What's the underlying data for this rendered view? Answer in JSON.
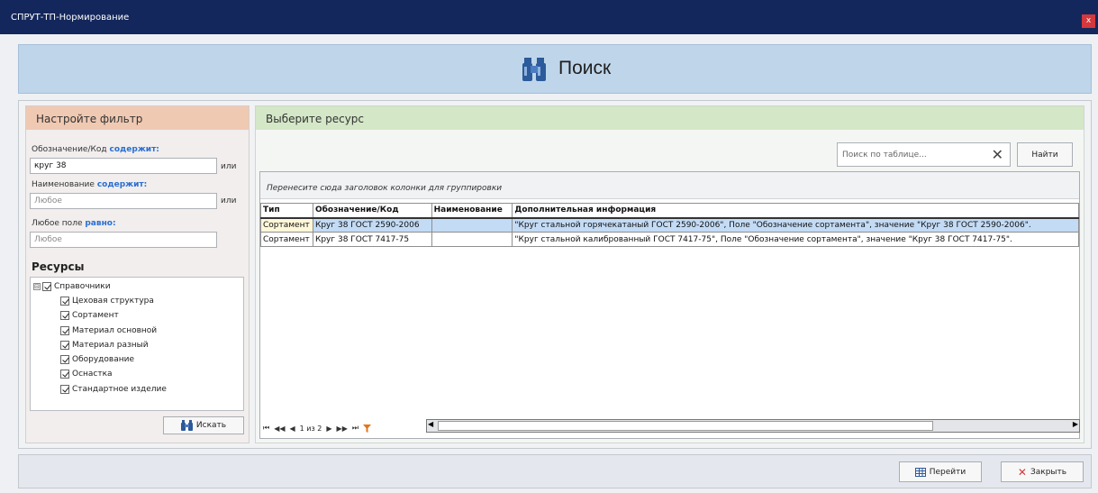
{
  "window": {
    "title": "СПРУТ-ТП-Нормирование",
    "close_label": "x"
  },
  "header": {
    "title": "Поиск",
    "icon": "binoculars-icon"
  },
  "filter_panel": {
    "title": "Настройте фильтр",
    "fields": [
      {
        "label": "Обозначение/Код",
        "op": "содержит:",
        "value": "круг 38",
        "placeholder": "",
        "connector": "или"
      },
      {
        "label": "Наименование",
        "op": "содержит:",
        "value": "",
        "placeholder": "Любое",
        "connector": "или"
      },
      {
        "label": "Любое поле",
        "op": "равно:",
        "value": "",
        "placeholder": "Любое",
        "connector": ""
      }
    ],
    "resources_title": "Ресурсы",
    "tree_root": {
      "expander": "⊟",
      "label": "Справочники",
      "checked": true
    },
    "tree_children": [
      {
        "label": "Цеховая структура",
        "checked": true
      },
      {
        "label": "Сортамент",
        "checked": true
      },
      {
        "label": "Материал основной",
        "checked": true
      },
      {
        "label": "Материал разный",
        "checked": true
      },
      {
        "label": "Оборудование",
        "checked": true
      },
      {
        "label": "Оснастка",
        "checked": true
      },
      {
        "label": "Стандартное изделие",
        "checked": true
      }
    ],
    "search_button": "Искать"
  },
  "resource_panel": {
    "title": "Выберите ресурс",
    "table_search_placeholder": "Поиск по таблице...",
    "find_button": "Найти",
    "group_hint": "Перенесите сюда заголовок колонки для группировки",
    "columns": [
      "Тип",
      "Обозначение/Код",
      "Наименование",
      "Дополнительная информация"
    ],
    "rows": [
      [
        "Сортамент",
        "Круг 38 ГОСТ 2590-2006",
        "",
        "\"Круг стальной горячекатаный ГОСТ 2590-2006\", Поле \"Обозначение сортамента\", значение \"Круг 38 ГОСТ 2590-2006\"."
      ],
      [
        "Сортамент",
        "Круг 38 ГОСТ 7417-75",
        "",
        "\"Круг стальной калиброванный ГОСТ 7417-75\", Поле \"Обозначение сортамента\", значение \"Круг 38 ГОСТ 7417-75\"."
      ]
    ],
    "selected_row": 0,
    "pager": {
      "first": "⏮",
      "prev_page": "◀◀",
      "prev": "◀",
      "info": "1 из 2",
      "next": "▶",
      "next_page": "▶▶",
      "last": "⏭"
    }
  },
  "footer": {
    "go_button": "Перейти",
    "close_button": "Закрыть"
  },
  "colors": {
    "titlebar": "#14275c",
    "header": "#bfd6ea",
    "filter_head": "#f0c9b2",
    "resource_head": "#d4e7c7",
    "selection": "#c3dbf5",
    "close_x": "#d4383c",
    "keyword": "#2a6fd1"
  }
}
